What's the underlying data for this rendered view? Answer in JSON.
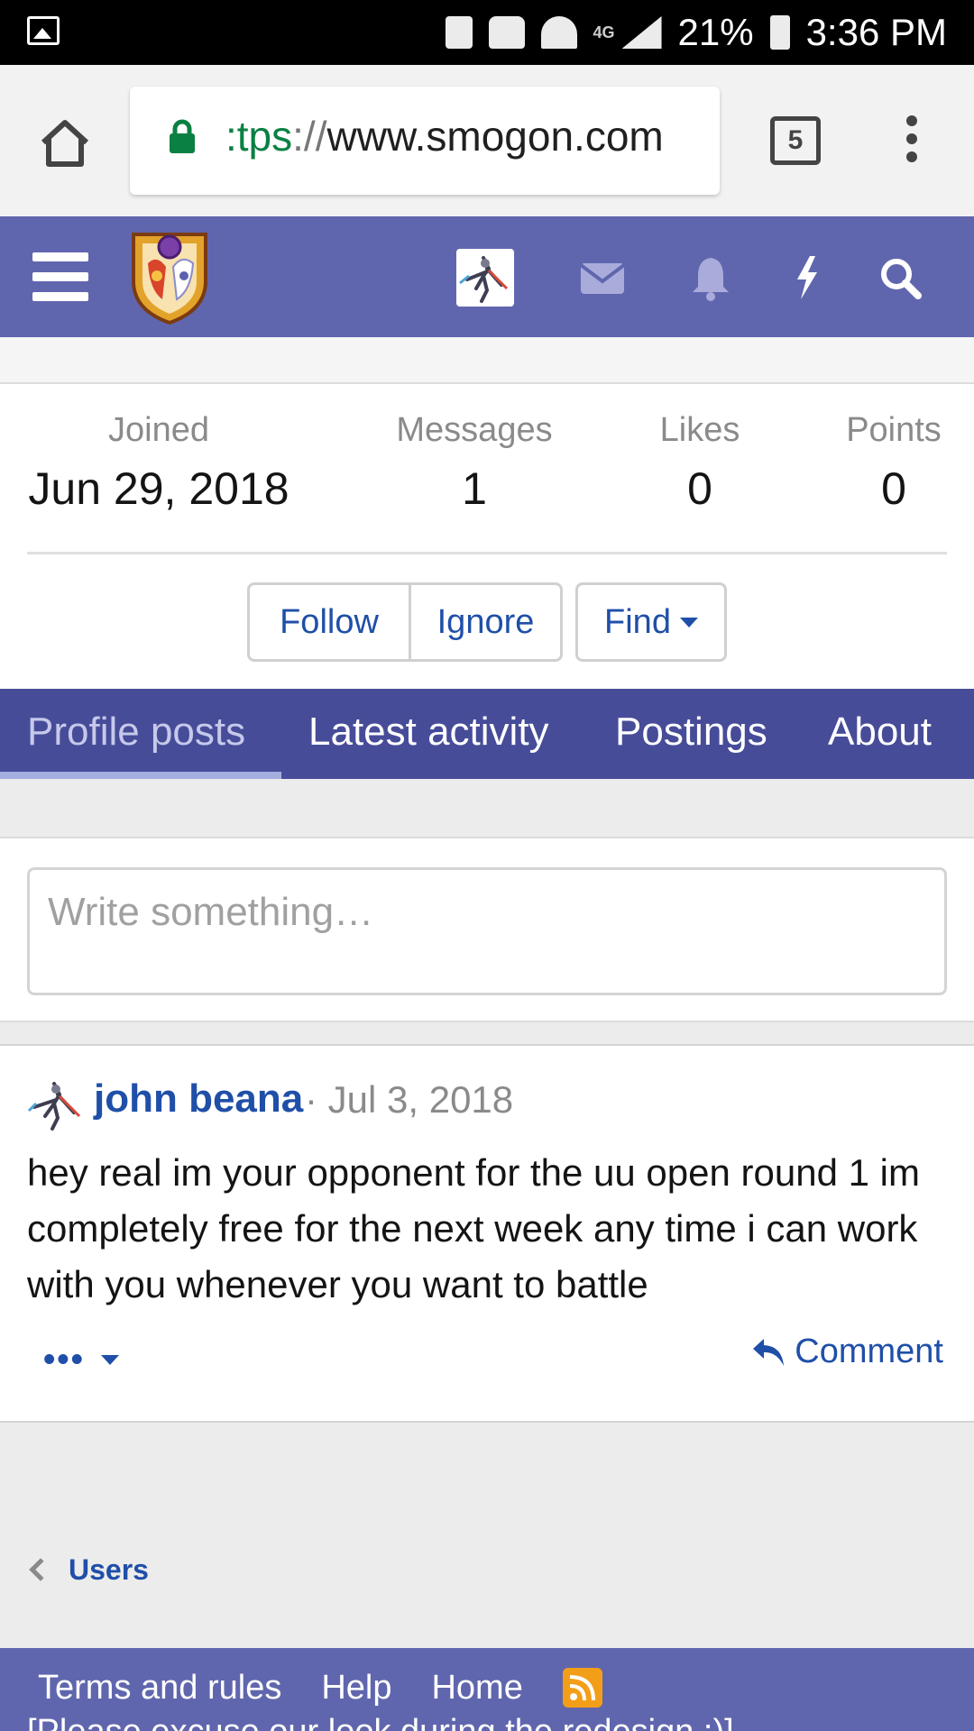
{
  "status_bar": {
    "network": "4G",
    "battery": "21%",
    "time": "3:36 PM"
  },
  "browser": {
    "url_scheme": ":tps",
    "url_sep": "://",
    "url_host": "www.smogon.com",
    "tab_count": "5"
  },
  "profile": {
    "stats": [
      {
        "label": "Joined",
        "value": "Jun 29, 2018"
      },
      {
        "label": "Messages",
        "value": "1"
      },
      {
        "label": "Likes",
        "value": "0"
      },
      {
        "label": "Points",
        "value": "0"
      }
    ],
    "buttons": {
      "follow": "Follow",
      "ignore": "Ignore",
      "find": "Find"
    }
  },
  "tabs": [
    {
      "label": "Profile posts",
      "active": true
    },
    {
      "label": "Latest activity",
      "active": false
    },
    {
      "label": "Postings",
      "active": false
    },
    {
      "label": "About",
      "active": false
    }
  ],
  "composer": {
    "placeholder": "Write something…"
  },
  "post": {
    "author": "john beana",
    "date": "· Jul 3, 2018",
    "body": "hey real im your opponent for the uu open round 1 im completely free for the next week any time i can work with you whenever you want to battle",
    "more": "•••",
    "comment": "Comment"
  },
  "breadcrumb": {
    "link": "Users"
  },
  "footer": {
    "links": [
      "Terms and rules",
      "Help",
      "Home"
    ],
    "note": "[Please excuse our look during the redesign :)]"
  },
  "colors": {
    "nav": "#6066ae",
    "tab_bar": "#474c99",
    "link": "#1f4fa8",
    "rss": "#f39e19"
  },
  "icons": [
    "gallery-icon",
    "home-icon",
    "lock-icon",
    "menu-icon",
    "hamburger-icon",
    "mail-icon",
    "bell-icon",
    "bolt-icon",
    "search-icon",
    "reply-icon",
    "rss-icon"
  ]
}
